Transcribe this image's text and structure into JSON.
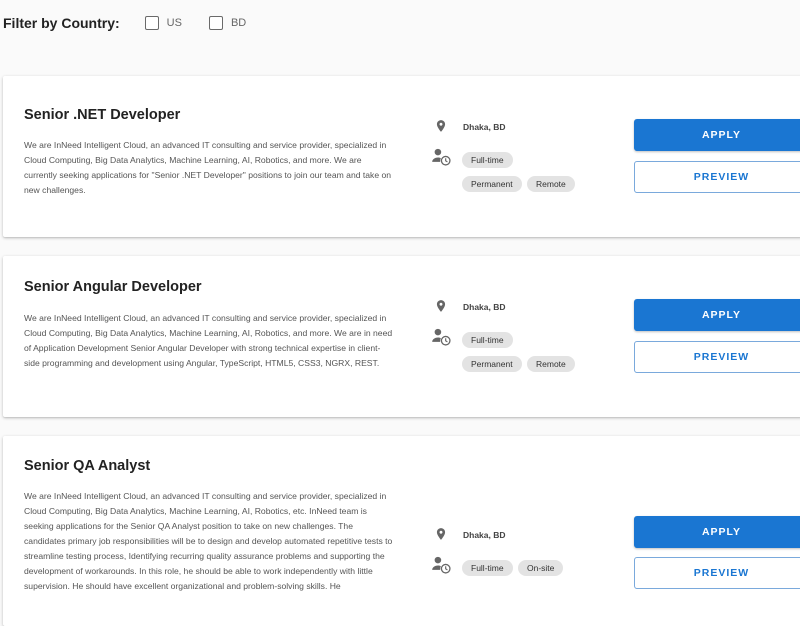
{
  "filter": {
    "title": "Filter by Country:",
    "options": [
      {
        "label": "US",
        "checked": false
      },
      {
        "label": "BD",
        "checked": false
      }
    ]
  },
  "jobs": [
    {
      "title": "Senior .NET Developer",
      "description": "We are InNeed Intelligent Cloud, an advanced IT consulting and service provider, specialized in Cloud Computing, Big Data Analytics, Machine Learning, AI, Robotics, and more. We are currently seeking applications for \"Senior .NET Developer\" positions to join our team and take on new challenges.",
      "location": "Dhaka, BD",
      "tags": [
        "Full-time",
        "Permanent",
        "Remote"
      ],
      "apply_label": "APPLY",
      "preview_label": "PREVIEW"
    },
    {
      "title": "Senior Angular Developer",
      "description": "We are InNeed Intelligent Cloud, an advanced IT consulting and service provider, specialized in Cloud Computing, Big Data Analytics, Machine Learning, AI, Robotics, and more. We are in need of Application Development Senior Angular Developer with strong technical expertise in client-side programming and development using Angular, TypeScript, HTML5, CSS3, NGRX, REST.",
      "location": "Dhaka, BD",
      "tags": [
        "Full-time",
        "Permanent",
        "Remote"
      ],
      "apply_label": "APPLY",
      "preview_label": "PREVIEW"
    },
    {
      "title": "Senior QA Analyst",
      "description": "We are InNeed Intelligent Cloud, an advanced IT consulting and service provider, specialized in Cloud Computing, Big Data Analytics, Machine Learning, AI, Robotics, etc. InNeed team is seeking applications for the Senior QA Analyst position to take on new challenges. The candidates primary job responsibilities will be to design and develop automated repetitive tests to streamline testing process, Identifying recurring quality assurance problems and supporting the development of workarounds. In this role, he should be able to work independently with little supervision. He should have excellent organizational and problem-solving skills. He",
      "location": "Dhaka, BD",
      "tags": [
        "Full-time",
        "On-site"
      ],
      "apply_label": "APPLY",
      "preview_label": "PREVIEW"
    }
  ]
}
